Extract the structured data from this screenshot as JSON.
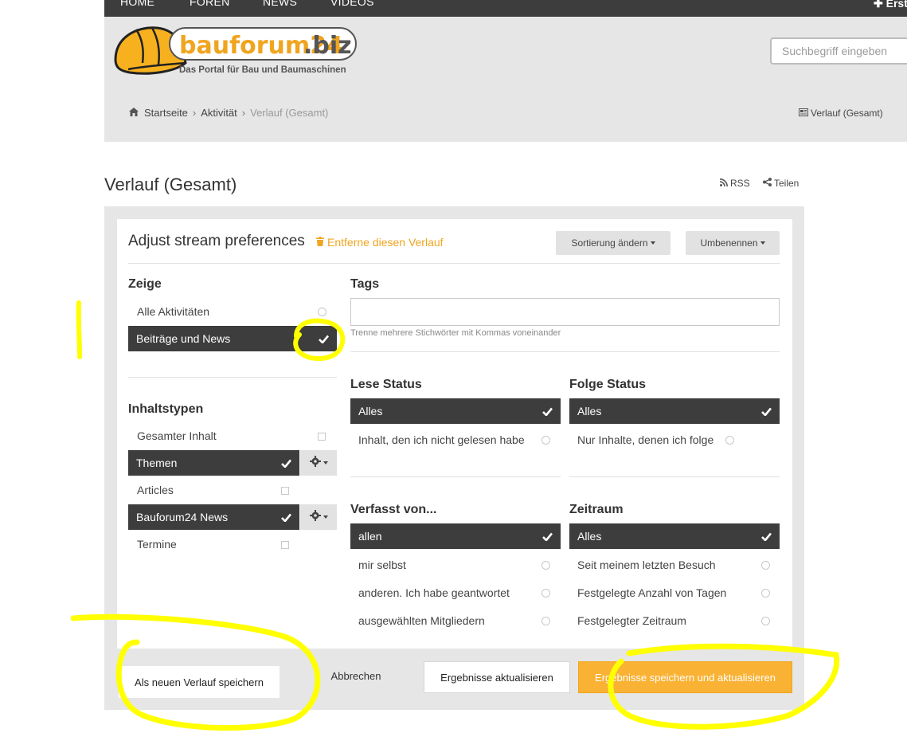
{
  "nav": {
    "items": [
      "HOME",
      "FOREN",
      "NEWS",
      "VIDEOS"
    ],
    "create_label": "Erstellen"
  },
  "header": {
    "logo_name": "bauforum24",
    "logo_tld": ".biz",
    "logo_tagline": "Das Portal für Bau und Baumaschinen",
    "search_placeholder": "Suchbegriff eingeben",
    "breadcrumb": {
      "home": "Startseite",
      "activity": "Aktivität",
      "current": "Verlauf (Gesamt)"
    },
    "view_dropdown": "Verlauf (Gesamt)"
  },
  "page": {
    "title": "Verlauf (Gesamt)",
    "rss": "RSS",
    "share": "Teilen"
  },
  "prefs": {
    "title": "Adjust stream preferences",
    "remove_link": "Entferne diesen Verlauf",
    "sort_button": "Sortierung ändern",
    "rename_button": "Umbenennen"
  },
  "zeige": {
    "heading": "Zeige",
    "options": [
      "Alle Aktivitäten",
      "Beiträge und News"
    ]
  },
  "inhaltstypen": {
    "heading": "Inhaltstypen",
    "options": [
      "Gesamter Inhalt",
      "Themen",
      "Articles",
      "Bauforum24 News",
      "Termine"
    ]
  },
  "tags": {
    "heading": "Tags",
    "hint": "Trenne mehrere Stichwörter mit Kommas voneinander"
  },
  "lese_status": {
    "heading": "Lese Status",
    "options": [
      "Alles",
      "Inhalt, den ich nicht gelesen habe"
    ]
  },
  "folge_status": {
    "heading": "Folge Status",
    "options": [
      "Alles",
      "Nur Inhalte, denen ich folge"
    ]
  },
  "verfasst": {
    "heading": "Verfasst von...",
    "options": [
      "allen",
      "mir selbst",
      "anderen. Ich habe geantwortet",
      "ausgewählten Mitgliedern"
    ]
  },
  "zeitraum": {
    "heading": "Zeitraum",
    "options": [
      "Alles",
      "Seit meinem letzten Besuch",
      "Festgelegte Anzahl von Tagen",
      "Festgelegter Zeitraum"
    ]
  },
  "footer": {
    "save_new": "Als neuen Verlauf speichern",
    "cancel": "Abbrechen",
    "update": "Ergebnisse aktualisieren",
    "save_update": "Ergebnisse speichern und aktualisieren"
  },
  "colors": {
    "accent": "#f0a51f",
    "dark": "#3d3d3d",
    "highlight": "#ffff00"
  }
}
